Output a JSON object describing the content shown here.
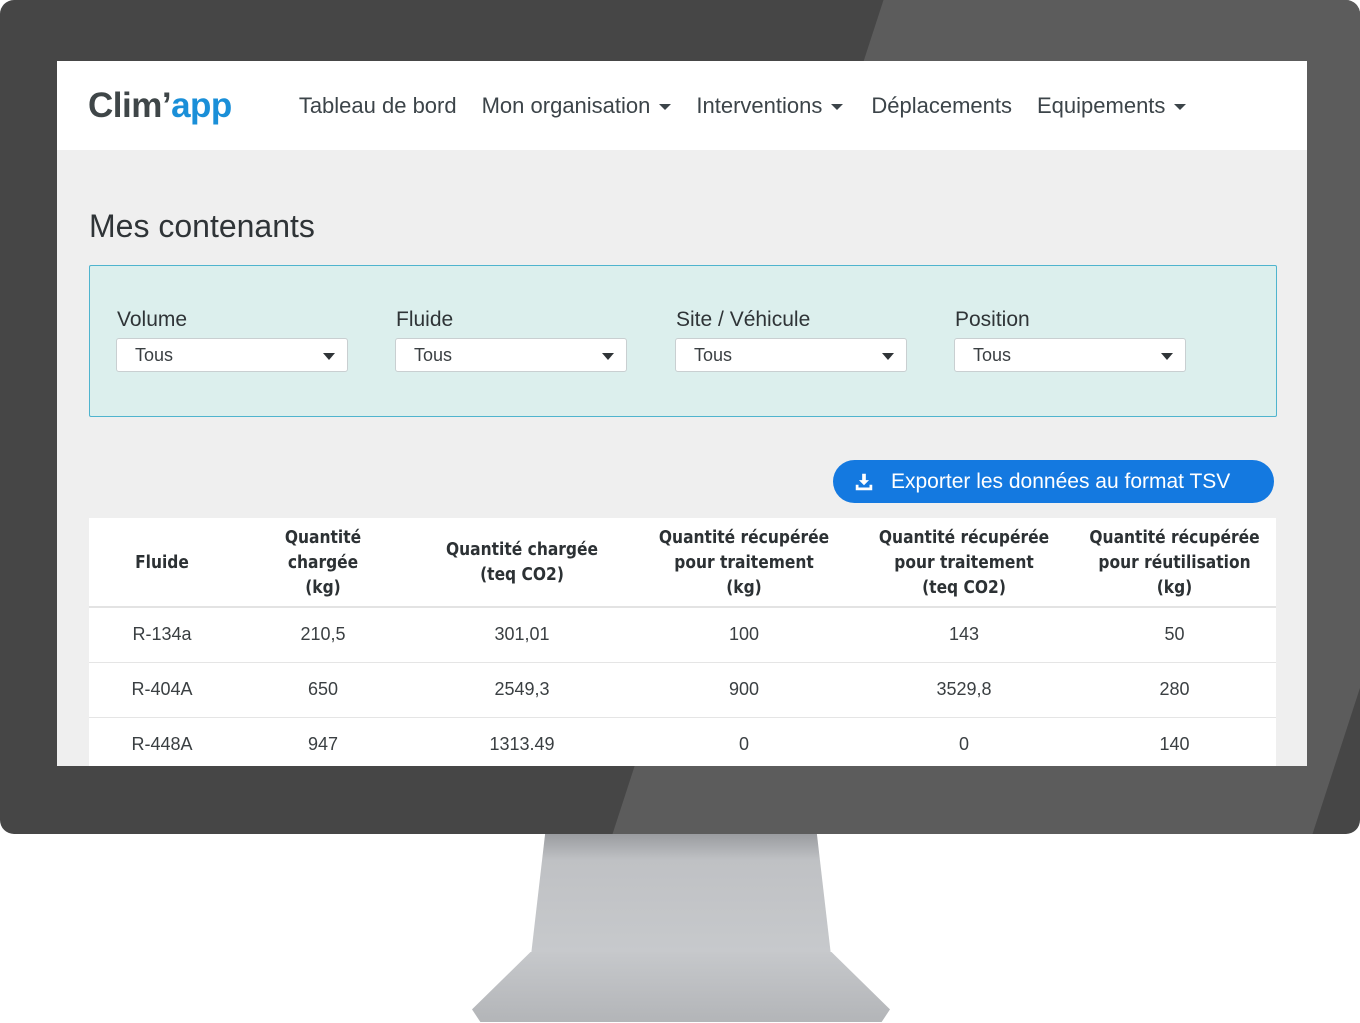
{
  "app": {
    "logo_left": "Clim’",
    "logo_right": "app"
  },
  "nav": {
    "items": [
      {
        "label": "Tableau de bord",
        "has_dropdown": false
      },
      {
        "label": "Mon organisation",
        "has_dropdown": true
      },
      {
        "label": "Interventions",
        "has_dropdown": true
      },
      {
        "label": "Déplacements",
        "has_dropdown": false
      },
      {
        "label": "Equipements",
        "has_dropdown": true
      }
    ]
  },
  "page": {
    "title": "Mes contenants"
  },
  "filters": [
    {
      "label": "Volume",
      "value": "Tous"
    },
    {
      "label": "Fluide",
      "value": "Tous"
    },
    {
      "label": "Site / Véhicule",
      "value": "Tous"
    },
    {
      "label": "Position",
      "value": "Tous"
    }
  ],
  "export": {
    "label": "Exporter les données au format TSV",
    "icon": "download-icon"
  },
  "table": {
    "headers": [
      [
        "Fluide"
      ],
      [
        "Quantité chargée",
        "(kg)"
      ],
      [
        "Quantité chargée",
        "(teq CO2)"
      ],
      [
        "Quantité récupérée",
        "pour traitement",
        "(kg)"
      ],
      [
        "Quantité récupérée",
        "pour traitement",
        "(teq CO2)"
      ],
      [
        "Quantité récupérée",
        "pour réutilisation",
        "(kg)"
      ]
    ],
    "rows": [
      [
        "R-134a",
        "210,5",
        "301,01",
        "100",
        "143",
        "50"
      ],
      [
        "R-404A",
        "650",
        "2549,3",
        "900",
        "3529,8",
        "280"
      ],
      [
        "R-448A",
        "947",
        "1313.49",
        "0",
        "0",
        "140"
      ]
    ]
  },
  "colors": {
    "accent": "#1479e0",
    "logo_blue": "#1a8fd8",
    "filter_bg": "#dcefed",
    "filter_border": "#4fb4ce"
  }
}
